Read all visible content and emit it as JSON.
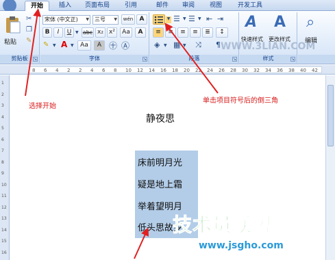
{
  "tabs": [
    {
      "label": "开始",
      "active": true
    },
    {
      "label": "插入"
    },
    {
      "label": "页面布局"
    },
    {
      "label": "引用"
    },
    {
      "label": "邮件"
    },
    {
      "label": "审阅"
    },
    {
      "label": "视图"
    },
    {
      "label": "开发工具"
    }
  ],
  "ribbon": {
    "clipboard": {
      "paste_label": "粘贴",
      "group_label": "剪贴板"
    },
    "font": {
      "font_name": "宋体 (中文正)",
      "font_size": "三号",
      "group_label": "字体",
      "bold": "B",
      "italic": "I",
      "underline": "U",
      "strike": "abc",
      "subscript": "x₂",
      "superscript": "x²",
      "change_case": "Aa",
      "char_shading": "A",
      "grow": "A",
      "wen": "wén",
      "clear_format": "A"
    },
    "paragraph": {
      "group_label": "段落"
    },
    "styles": {
      "quick_styles": "快速样式",
      "change_styles": "更改样式",
      "group_label": "样式"
    },
    "editing": {
      "label": "编辑"
    }
  },
  "ruler": {
    "numbers": [
      "8",
      "6",
      "4",
      "2",
      "2",
      "4",
      "6",
      "8",
      "10",
      "12",
      "14",
      "16",
      "18",
      "20",
      "22",
      "24",
      "26",
      "28",
      "30",
      "32",
      "34",
      "36",
      "38",
      "40",
      "42"
    ]
  },
  "vruler": {
    "numbers": [
      "1",
      "2",
      "3",
      "4",
      "5",
      "6",
      "7",
      "8",
      "9",
      "10",
      "11",
      "12",
      "13",
      "14",
      "15",
      "16"
    ]
  },
  "annotations": {
    "start": "选择开始",
    "bullet": "单击项目符号后的倒三角"
  },
  "document": {
    "title": "静夜思",
    "lines": [
      "床前明月光",
      "疑是地上霜",
      "举着望明月",
      "低头思故乡"
    ]
  },
  "watermark": {
    "main": "技术员联盟",
    "url": "www.jsgho.com",
    "url2": "WWW.3LIAN.COM"
  },
  "colors": {
    "accent": "#15428b",
    "annotation": "#d71a1a",
    "selection": "#b3cde8",
    "watermark_green": "#2fb12f",
    "watermark_blue": "#2c9ad8"
  }
}
